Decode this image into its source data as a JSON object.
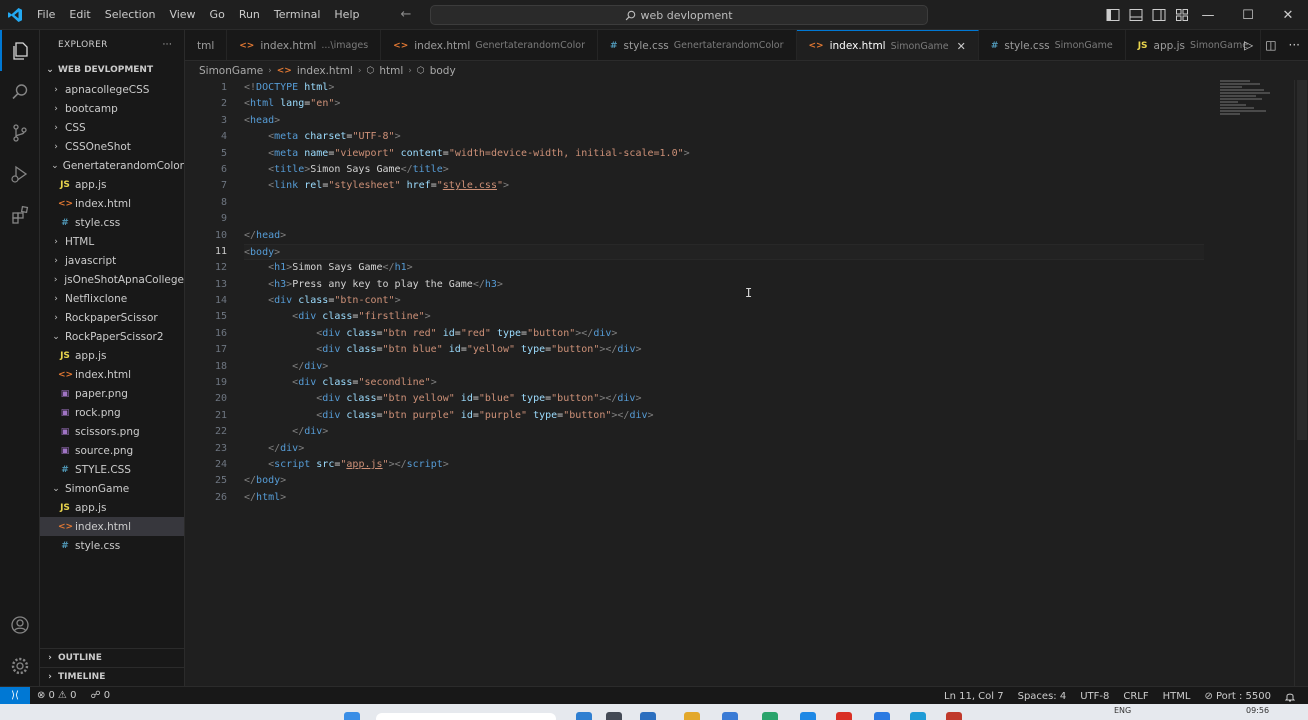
{
  "titlebar": {
    "menu": [
      "File",
      "Edit",
      "Selection",
      "View",
      "Go",
      "Run",
      "Terminal",
      "Help"
    ],
    "search_text": "web devlopment",
    "logo_color": "#23a9f2"
  },
  "sidebar": {
    "header": "EXPLORER",
    "more": "···",
    "root": "WEB DEVLOPMENT",
    "items": [
      {
        "label": "apnacollegeCSS",
        "kind": "folder",
        "depth": 1,
        "open": false
      },
      {
        "label": "bootcamp",
        "kind": "folder",
        "depth": 1,
        "open": false
      },
      {
        "label": "CSS",
        "kind": "folder",
        "depth": 1,
        "open": false
      },
      {
        "label": "CSSOneShot",
        "kind": "folder",
        "depth": 1,
        "open": false
      },
      {
        "label": "GenertaterandomColor",
        "kind": "folder",
        "depth": 1,
        "open": true
      },
      {
        "label": "app.js",
        "kind": "js",
        "depth": 2
      },
      {
        "label": "index.html",
        "kind": "html",
        "depth": 2
      },
      {
        "label": "style.css",
        "kind": "css",
        "depth": 2
      },
      {
        "label": "HTML",
        "kind": "folder",
        "depth": 1,
        "open": false
      },
      {
        "label": "javascript",
        "kind": "folder",
        "depth": 1,
        "open": false
      },
      {
        "label": "jsOneShotApnaCollege",
        "kind": "folder",
        "depth": 1,
        "open": false
      },
      {
        "label": "Netflixclone",
        "kind": "folder",
        "depth": 1,
        "open": false
      },
      {
        "label": "RockpaperScissor",
        "kind": "folder",
        "depth": 1,
        "open": false
      },
      {
        "label": "RockPaperScissor2",
        "kind": "folder",
        "depth": 1,
        "open": true
      },
      {
        "label": "app.js",
        "kind": "js",
        "depth": 2
      },
      {
        "label": "index.html",
        "kind": "html",
        "depth": 2
      },
      {
        "label": "paper.png",
        "kind": "img",
        "depth": 2
      },
      {
        "label": "rock.png",
        "kind": "img",
        "depth": 2
      },
      {
        "label": "scissors.png",
        "kind": "img",
        "depth": 2
      },
      {
        "label": "source.png",
        "kind": "img",
        "depth": 2
      },
      {
        "label": "STYLE.CSS",
        "kind": "css",
        "depth": 2
      },
      {
        "label": "SimonGame",
        "kind": "folder",
        "depth": 1,
        "open": true
      },
      {
        "label": "app.js",
        "kind": "js",
        "depth": 2
      },
      {
        "label": "index.html",
        "kind": "html",
        "depth": 2,
        "selected": true
      },
      {
        "label": "style.css",
        "kind": "css",
        "depth": 2
      }
    ],
    "outline": "OUTLINE",
    "timeline": "TIMELINE"
  },
  "file_icons": {
    "js": "JS",
    "html": "<>",
    "css": "#",
    "img": "▣"
  },
  "tabs": [
    {
      "label": "tml",
      "desc": "",
      "kind": "",
      "active": false
    },
    {
      "label": "index.html",
      "desc": "...\\images",
      "kind": "html",
      "active": false
    },
    {
      "label": "index.html",
      "desc": "GenertaterandomColor",
      "kind": "html",
      "active": false
    },
    {
      "label": "style.css",
      "desc": "GenertaterandomColor",
      "kind": "css",
      "active": false
    },
    {
      "label": "index.html",
      "desc": "SimonGame",
      "kind": "html",
      "active": true
    },
    {
      "label": "style.css",
      "desc": "SimonGame",
      "kind": "css",
      "active": false
    },
    {
      "label": "app.js",
      "desc": "SimonGame",
      "kind": "js",
      "active": false
    }
  ],
  "breadcrumb": [
    "SimonGame",
    "index.html",
    "html",
    "body"
  ],
  "editor": {
    "current_line": 11,
    "lines": [
      [
        [
          "br",
          "<!"
        ],
        [
          "tag",
          "DOCTYPE"
        ],
        [
          "txt",
          " "
        ],
        [
          "attr",
          "html"
        ],
        [
          "br",
          ">"
        ]
      ],
      [
        [
          "br",
          "<"
        ],
        [
          "tag",
          "html"
        ],
        [
          "txt",
          " "
        ],
        [
          "attr",
          "lang"
        ],
        [
          "txt",
          "="
        ],
        [
          "str",
          "\"en\""
        ],
        [
          "br",
          ">"
        ]
      ],
      [
        [
          "br",
          "<"
        ],
        [
          "tag",
          "head"
        ],
        [
          "br",
          ">"
        ]
      ],
      [
        [
          "txt",
          "    "
        ],
        [
          "br",
          "<"
        ],
        [
          "tag",
          "meta"
        ],
        [
          "txt",
          " "
        ],
        [
          "attr",
          "charset"
        ],
        [
          "txt",
          "="
        ],
        [
          "str",
          "\"UTF-8\""
        ],
        [
          "br",
          ">"
        ]
      ],
      [
        [
          "txt",
          "    "
        ],
        [
          "br",
          "<"
        ],
        [
          "tag",
          "meta"
        ],
        [
          "txt",
          " "
        ],
        [
          "attr",
          "name"
        ],
        [
          "txt",
          "="
        ],
        [
          "str",
          "\"viewport\""
        ],
        [
          "txt",
          " "
        ],
        [
          "attr",
          "content"
        ],
        [
          "txt",
          "="
        ],
        [
          "str",
          "\"width=device-width, initial-scale=1.0\""
        ],
        [
          "br",
          ">"
        ]
      ],
      [
        [
          "txt",
          "    "
        ],
        [
          "br",
          "<"
        ],
        [
          "tag",
          "title"
        ],
        [
          "br",
          ">"
        ],
        [
          "txt",
          "Simon Says Game"
        ],
        [
          "br",
          "</"
        ],
        [
          "tag",
          "title"
        ],
        [
          "br",
          ">"
        ]
      ],
      [
        [
          "txt",
          "    "
        ],
        [
          "br",
          "<"
        ],
        [
          "tag",
          "link"
        ],
        [
          "txt",
          " "
        ],
        [
          "attr",
          "rel"
        ],
        [
          "txt",
          "="
        ],
        [
          "str",
          "\"stylesheet\""
        ],
        [
          "txt",
          " "
        ],
        [
          "attr",
          "href"
        ],
        [
          "txt",
          "="
        ],
        [
          "str",
          "\""
        ],
        [
          "strul",
          "style.css"
        ],
        [
          "str",
          "\""
        ],
        [
          "br",
          ">"
        ]
      ],
      [],
      [],
      [
        [
          "br",
          "</"
        ],
        [
          "tag",
          "head"
        ],
        [
          "br",
          ">"
        ]
      ],
      [
        [
          "br",
          "<"
        ],
        [
          "tag",
          "body"
        ],
        [
          "br",
          ">"
        ]
      ],
      [
        [
          "txt",
          "    "
        ],
        [
          "br",
          "<"
        ],
        [
          "tag",
          "h1"
        ],
        [
          "br",
          ">"
        ],
        [
          "txt",
          "Simon Says Game"
        ],
        [
          "br",
          "</"
        ],
        [
          "tag",
          "h1"
        ],
        [
          "br",
          ">"
        ]
      ],
      [
        [
          "txt",
          "    "
        ],
        [
          "br",
          "<"
        ],
        [
          "tag",
          "h3"
        ],
        [
          "br",
          ">"
        ],
        [
          "txt",
          "Press any key to play the Game"
        ],
        [
          "br",
          "</"
        ],
        [
          "tag",
          "h3"
        ],
        [
          "br",
          ">"
        ]
      ],
      [
        [
          "txt",
          "    "
        ],
        [
          "br",
          "<"
        ],
        [
          "tag",
          "div"
        ],
        [
          "txt",
          " "
        ],
        [
          "attr",
          "class"
        ],
        [
          "txt",
          "="
        ],
        [
          "str",
          "\"btn-cont\""
        ],
        [
          "br",
          ">"
        ]
      ],
      [
        [
          "txt",
          "        "
        ],
        [
          "br",
          "<"
        ],
        [
          "tag",
          "div"
        ],
        [
          "txt",
          " "
        ],
        [
          "attr",
          "class"
        ],
        [
          "txt",
          "="
        ],
        [
          "str",
          "\"firstline\""
        ],
        [
          "br",
          ">"
        ]
      ],
      [
        [
          "txt",
          "            "
        ],
        [
          "br",
          "<"
        ],
        [
          "tag",
          "div"
        ],
        [
          "txt",
          " "
        ],
        [
          "attr",
          "class"
        ],
        [
          "txt",
          "="
        ],
        [
          "str",
          "\"btn red\""
        ],
        [
          "txt",
          " "
        ],
        [
          "attr",
          "id"
        ],
        [
          "txt",
          "="
        ],
        [
          "str",
          "\"red\""
        ],
        [
          "txt",
          " "
        ],
        [
          "attr",
          "type"
        ],
        [
          "txt",
          "="
        ],
        [
          "str",
          "\"button\""
        ],
        [
          "br",
          "></"
        ],
        [
          "tag",
          "div"
        ],
        [
          "br",
          ">"
        ]
      ],
      [
        [
          "txt",
          "            "
        ],
        [
          "br",
          "<"
        ],
        [
          "tag",
          "div"
        ],
        [
          "txt",
          " "
        ],
        [
          "attr",
          "class"
        ],
        [
          "txt",
          "="
        ],
        [
          "str",
          "\"btn blue\""
        ],
        [
          "txt",
          " "
        ],
        [
          "attr",
          "id"
        ],
        [
          "txt",
          "="
        ],
        [
          "str",
          "\"yellow\""
        ],
        [
          "txt",
          " "
        ],
        [
          "attr",
          "type"
        ],
        [
          "txt",
          "="
        ],
        [
          "str",
          "\"button\""
        ],
        [
          "br",
          "></"
        ],
        [
          "tag",
          "div"
        ],
        [
          "br",
          ">"
        ]
      ],
      [
        [
          "txt",
          "        "
        ],
        [
          "br",
          "</"
        ],
        [
          "tag",
          "div"
        ],
        [
          "br",
          ">"
        ]
      ],
      [
        [
          "txt",
          "        "
        ],
        [
          "br",
          "<"
        ],
        [
          "tag",
          "div"
        ],
        [
          "txt",
          " "
        ],
        [
          "attr",
          "class"
        ],
        [
          "txt",
          "="
        ],
        [
          "str",
          "\"secondline\""
        ],
        [
          "br",
          ">"
        ]
      ],
      [
        [
          "txt",
          "            "
        ],
        [
          "br",
          "<"
        ],
        [
          "tag",
          "div"
        ],
        [
          "txt",
          " "
        ],
        [
          "attr",
          "class"
        ],
        [
          "txt",
          "="
        ],
        [
          "str",
          "\"btn yellow\""
        ],
        [
          "txt",
          " "
        ],
        [
          "attr",
          "id"
        ],
        [
          "txt",
          "="
        ],
        [
          "str",
          "\"blue\""
        ],
        [
          "txt",
          " "
        ],
        [
          "attr",
          "type"
        ],
        [
          "txt",
          "="
        ],
        [
          "str",
          "\"button\""
        ],
        [
          "br",
          "></"
        ],
        [
          "tag",
          "div"
        ],
        [
          "br",
          ">"
        ]
      ],
      [
        [
          "txt",
          "            "
        ],
        [
          "br",
          "<"
        ],
        [
          "tag",
          "div"
        ],
        [
          "txt",
          " "
        ],
        [
          "attr",
          "class"
        ],
        [
          "txt",
          "="
        ],
        [
          "str",
          "\"btn purple\""
        ],
        [
          "txt",
          " "
        ],
        [
          "attr",
          "id"
        ],
        [
          "txt",
          "="
        ],
        [
          "str",
          "\"purple\""
        ],
        [
          "txt",
          " "
        ],
        [
          "attr",
          "type"
        ],
        [
          "txt",
          "="
        ],
        [
          "str",
          "\"button\""
        ],
        [
          "br",
          "></"
        ],
        [
          "tag",
          "div"
        ],
        [
          "br",
          ">"
        ]
      ],
      [
        [
          "txt",
          "        "
        ],
        [
          "br",
          "</"
        ],
        [
          "tag",
          "div"
        ],
        [
          "br",
          ">"
        ]
      ],
      [
        [
          "txt",
          "    "
        ],
        [
          "br",
          "</"
        ],
        [
          "tag",
          "div"
        ],
        [
          "br",
          ">"
        ]
      ],
      [
        [
          "txt",
          "    "
        ],
        [
          "br",
          "<"
        ],
        [
          "tag",
          "script"
        ],
        [
          "txt",
          " "
        ],
        [
          "attr",
          "src"
        ],
        [
          "txt",
          "="
        ],
        [
          "str",
          "\""
        ],
        [
          "strul",
          "app.js"
        ],
        [
          "str",
          "\""
        ],
        [
          "br",
          "></"
        ],
        [
          "tag",
          "script"
        ],
        [
          "br",
          ">"
        ]
      ],
      [
        [
          "br",
          "</"
        ],
        [
          "tag",
          "body"
        ],
        [
          "br",
          ">"
        ]
      ],
      [
        [
          "br",
          "</"
        ],
        [
          "tag",
          "html"
        ],
        [
          "br",
          ">"
        ]
      ]
    ]
  },
  "statusbar": {
    "remote": "⟩⟨",
    "errors": "⊗ 0",
    "warnings": "⚠ 0",
    "ports_radio": "☍ 0",
    "position": "Ln 11, Col 7",
    "spaces": "Spaces: 4",
    "encoding": "UTF-8",
    "eol": "CRLF",
    "language": "HTML",
    "live_server": "⊘ Port : 5500",
    "bell": "🔔"
  },
  "taskbar": {
    "lang": "ENG",
    "time": "09:56"
  },
  "colors": {
    "accent": "#0078d4",
    "tag": "#569cd6",
    "attr": "#9cdcfe",
    "string": "#ce9178"
  }
}
